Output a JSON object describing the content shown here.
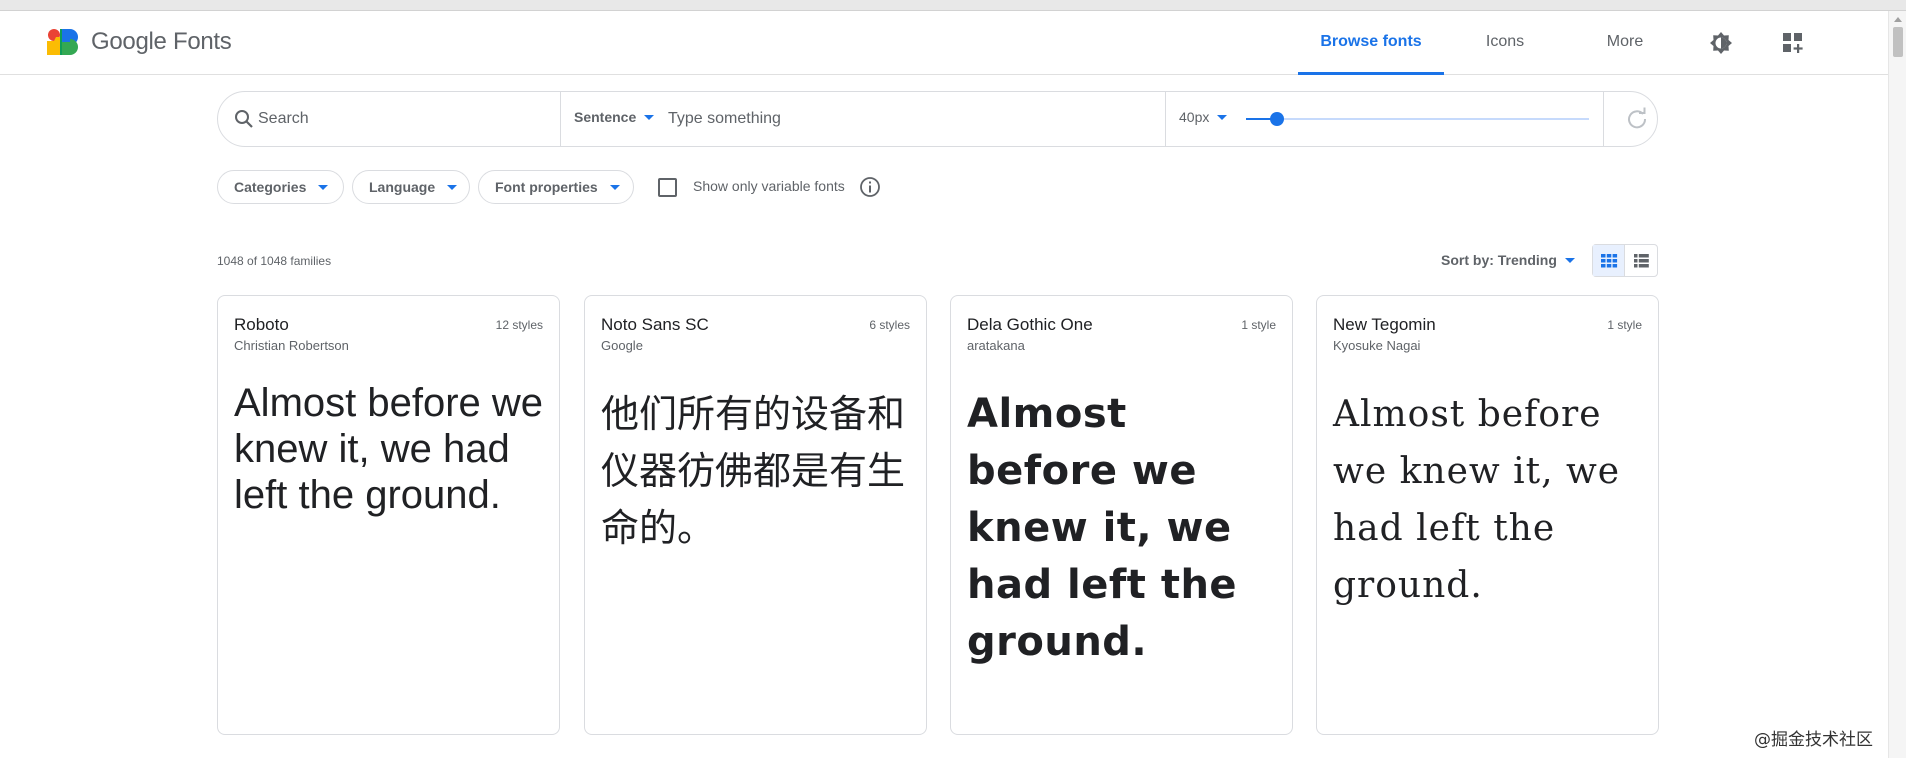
{
  "header": {
    "brand": "Google Fonts",
    "nav": [
      {
        "label": "Browse fonts",
        "active": true
      },
      {
        "label": "Icons",
        "active": false
      },
      {
        "label": "More",
        "active": false
      }
    ],
    "icons": {
      "theme": "brightness-icon",
      "apps": "apps-add-icon"
    },
    "accent_color": "#1a73e8"
  },
  "toolbar": {
    "search_placeholder": "Search",
    "sentence_mode": "Sentence",
    "type_placeholder": "Type something",
    "font_size": "40px",
    "slider_fraction": 0.09
  },
  "filters": {
    "categories": "Categories",
    "language": "Language",
    "font_properties": "Font properties",
    "variable_label": "Show only variable fonts",
    "variable_checked": false
  },
  "results": {
    "count": "1048 of 1048 families",
    "sort": "Sort by: Trending",
    "view": "grid"
  },
  "cards": [
    {
      "name": "Roboto",
      "author": "Christian Robertson",
      "styles": "12 styles",
      "sample": "Almost before we knew it, we had left the ground."
    },
    {
      "name": "Noto Sans SC",
      "author": "Google",
      "styles": "6 styles",
      "sample": "他们所有的设备和仪器彷佛都是有生命的。"
    },
    {
      "name": "Dela Gothic One",
      "author": "aratakana",
      "styles": "1 style",
      "sample": "Almost before we knew it, we had left the ground."
    },
    {
      "name": "New Tegomin",
      "author": "Kyosuke Nagai",
      "styles": "1 style",
      "sample": "Almost before we knew it, we had left the ground."
    }
  ],
  "watermark": "@掘金技术社区"
}
